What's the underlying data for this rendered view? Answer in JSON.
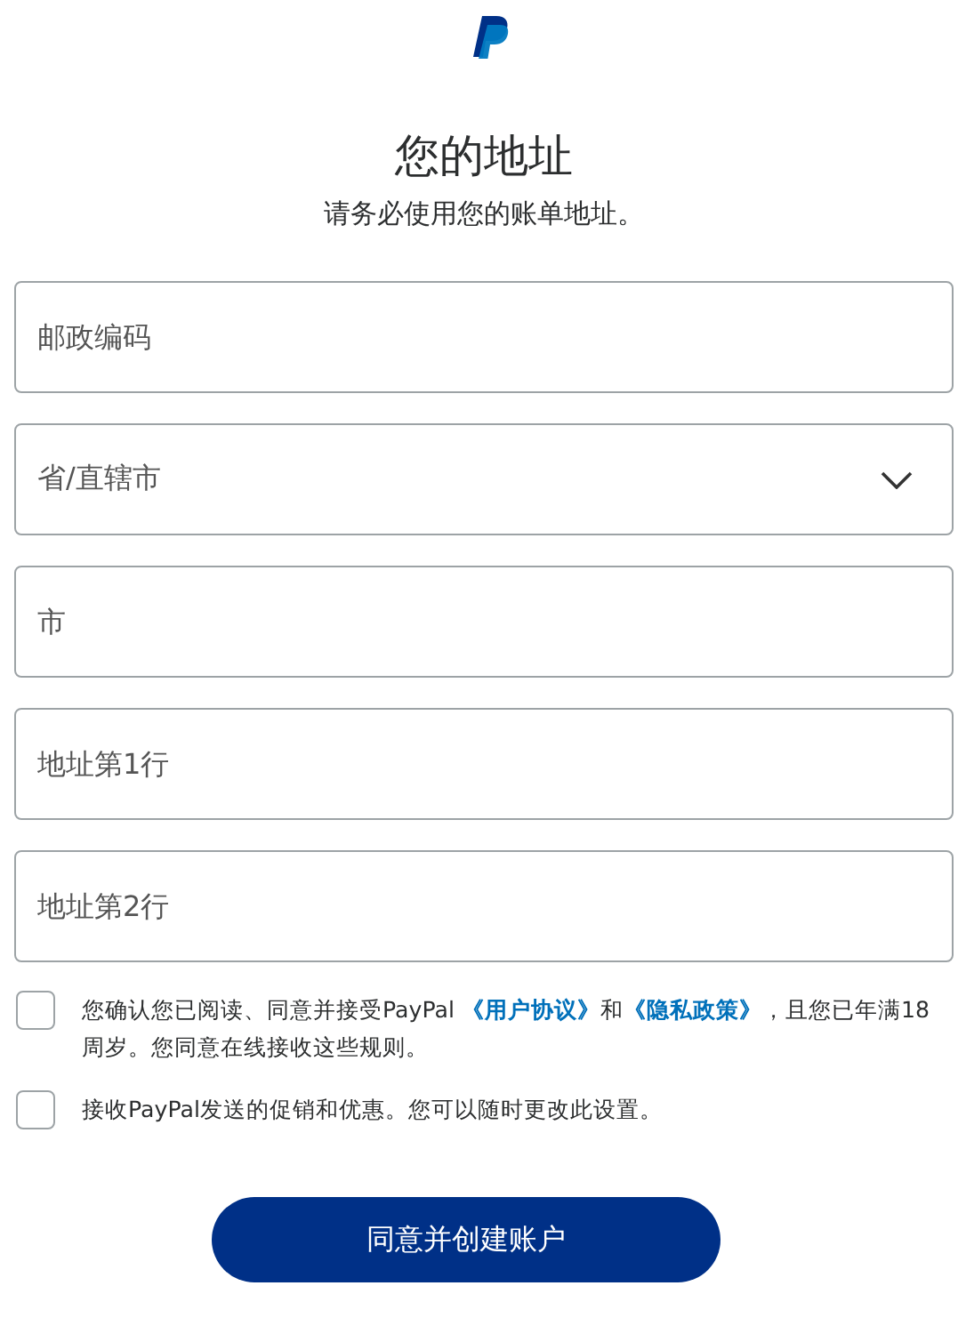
{
  "header": {
    "title": "您的地址",
    "subtitle": "请务必使用您的账单地址。"
  },
  "fields": [
    {
      "kind": "text",
      "placeholder": "邮政编码"
    },
    {
      "kind": "select",
      "placeholder": "省/直辖市"
    },
    {
      "kind": "text",
      "placeholder": "市"
    },
    {
      "kind": "text",
      "placeholder": "地址第1行"
    },
    {
      "kind": "text",
      "placeholder": "地址第2行"
    }
  ],
  "checkboxes": [
    {
      "checked": false,
      "parts": [
        {
          "kind": "text",
          "text": "您确认您已阅读、同意并接受PayPal "
        },
        {
          "kind": "link",
          "text": "《用户协议》"
        },
        {
          "kind": "text",
          "text": "和"
        },
        {
          "kind": "link",
          "text": "《隐私政策》"
        },
        {
          "kind": "text",
          "text": "，且您已年满18周岁。您同意在线接收这些规则。"
        }
      ]
    },
    {
      "checked": false,
      "parts": [
        {
          "kind": "text",
          "text": "接收PayPal发送的促销和优惠。您可以随时更改此设置。"
        }
      ]
    }
  ],
  "submit": "同意并创建账户"
}
